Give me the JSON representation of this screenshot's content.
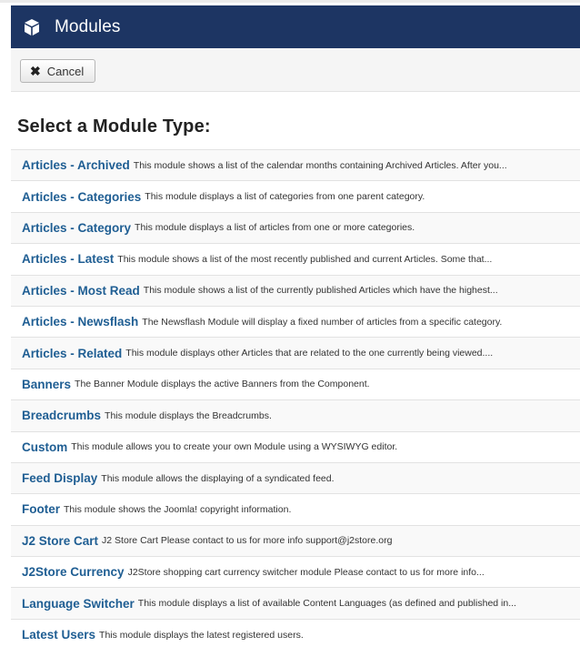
{
  "header": {
    "title": "Modules",
    "icon": "cube-icon"
  },
  "toolbar": {
    "cancel_label": "Cancel"
  },
  "heading": "Select a Module Type:",
  "modules": [
    {
      "name": "Articles - Archived",
      "desc": "This module shows a list of the calendar months containing Archived Articles. After you..."
    },
    {
      "name": "Articles - Categories",
      "desc": "This module displays a list of categories from one parent category."
    },
    {
      "name": "Articles - Category",
      "desc": "This module displays a list of articles from one or more categories."
    },
    {
      "name": "Articles - Latest",
      "desc": "This module shows a list of the most recently published and current Articles. Some that..."
    },
    {
      "name": "Articles - Most Read",
      "desc": "This module shows a list of the currently published Articles which have the highest..."
    },
    {
      "name": "Articles - Newsflash",
      "desc": "The Newsflash Module will display a fixed number of articles from a specific category."
    },
    {
      "name": "Articles - Related",
      "desc": "This module displays other Articles that are related to the one currently being viewed...."
    },
    {
      "name": "Banners",
      "desc": "The Banner Module displays the active Banners from the Component."
    },
    {
      "name": "Breadcrumbs",
      "desc": "This module displays the Breadcrumbs."
    },
    {
      "name": "Custom",
      "desc": "This module allows you to create your own Module using a WYSIWYG editor."
    },
    {
      "name": "Feed Display",
      "desc": "This module allows the displaying of a syndicated feed."
    },
    {
      "name": "Footer",
      "desc": "This module shows the Joomla! copyright information."
    },
    {
      "name": "J2 Store Cart",
      "desc": "J2 Store Cart Please contact to us for more info support@j2store.org"
    },
    {
      "name": "J2Store Currency",
      "desc": "J2Store shopping cart currency switcher module Please contact to us for more info..."
    },
    {
      "name": "Language Switcher",
      "desc": "This module displays a list of available Content Languages (as defined and published in..."
    },
    {
      "name": "Latest Users",
      "desc": "This module displays the latest registered users."
    }
  ]
}
